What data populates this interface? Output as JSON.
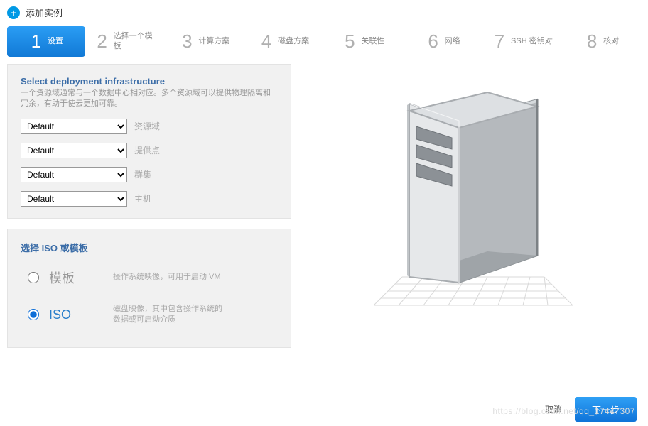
{
  "header": {
    "title": "添加实例",
    "plus_glyph": "+"
  },
  "steps": [
    {
      "num": "1",
      "label": "设置",
      "active": true
    },
    {
      "num": "2",
      "label": "选择一个模板",
      "active": false
    },
    {
      "num": "3",
      "label": "计算方案",
      "active": false
    },
    {
      "num": "4",
      "label": "磁盘方案",
      "active": false
    },
    {
      "num": "5",
      "label": "关联性",
      "active": false
    },
    {
      "num": "6",
      "label": "网络",
      "active": false
    },
    {
      "num": "7",
      "label": "SSH 密钥对",
      "active": false
    },
    {
      "num": "8",
      "label": "核对",
      "active": false
    }
  ],
  "panel1": {
    "title": "Select deployment infrastructure",
    "desc": "一个资源域通常与一个数据中心相对应。多个资源域可以提供物理隔离和冗余，有助于使云更加可靠。",
    "fields": [
      {
        "value": "Default",
        "label": "资源域"
      },
      {
        "value": "Default",
        "label": "提供点"
      },
      {
        "value": "Default",
        "label": "群集"
      },
      {
        "value": "Default",
        "label": "主机"
      }
    ]
  },
  "panel2": {
    "title": "选择 ISO 或模板",
    "options": [
      {
        "label": "模板",
        "desc": "操作系统映像，可用于启动 VM",
        "selected": false
      },
      {
        "label": "ISO",
        "desc": "磁盘映像，其中包含操作系统的数据或可启动介质",
        "selected": true
      }
    ]
  },
  "footer": {
    "cancel": "取消",
    "next": "下一步"
  },
  "watermark": "https://blog.csdn.net/qq_17447307"
}
